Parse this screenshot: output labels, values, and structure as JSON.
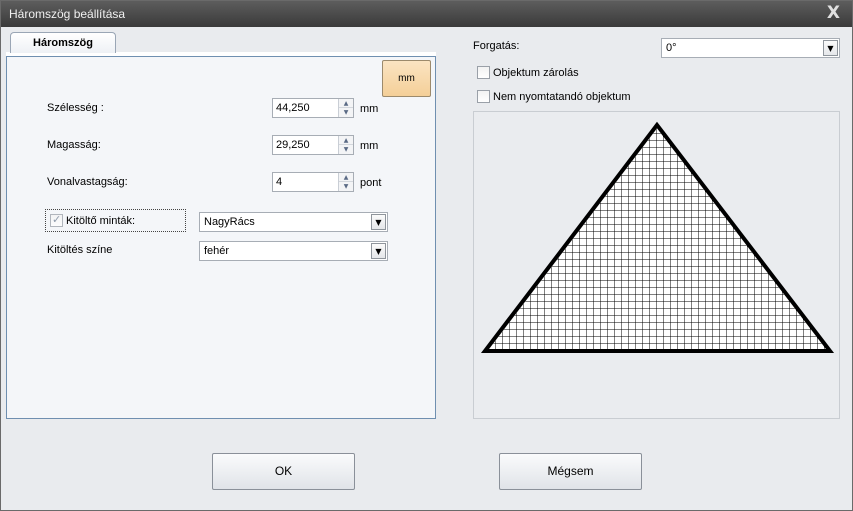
{
  "window": {
    "title": "Háromszög beállítása",
    "close_glyph": "X"
  },
  "tab": {
    "label": "Háromszög"
  },
  "unit_button": {
    "label": "mm"
  },
  "fields": {
    "width": {
      "label": "Szélesség :",
      "value": "44,250",
      "unit": "mm"
    },
    "height": {
      "label": "Magasság:",
      "value": "29,250",
      "unit": "mm"
    },
    "line_width": {
      "label": "Vonalvastagság:",
      "value": "4",
      "unit": "pont"
    }
  },
  "fill_pattern": {
    "label": "Kitöltő minták:",
    "checked": true,
    "value": "NagyRács"
  },
  "fill_color": {
    "label": "Kitöltés színe",
    "value": "fehér"
  },
  "rotation": {
    "label": "Forgatás:",
    "value": "0°"
  },
  "object_lock": {
    "label": "Objektum zárolás",
    "checked": false
  },
  "non_printable": {
    "label": "Nem nyomtatandó objektum",
    "checked": false
  },
  "buttons": {
    "ok": "OK",
    "cancel": "Mégsem"
  },
  "colors": {
    "titlebar": "#474747",
    "unit_button": "#f6d7a8",
    "panel_border": "#6f8fb0",
    "triangle_stroke": "#000000",
    "grid": "#000000"
  },
  "icons": {
    "spin_up": "▲",
    "spin_down": "▼",
    "dropdown": "▼"
  }
}
